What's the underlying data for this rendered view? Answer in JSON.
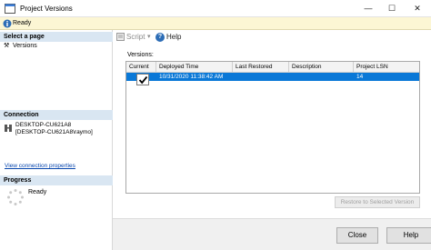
{
  "window": {
    "title": "Project Versions",
    "minimize_symbol": "—",
    "maximize_symbol": "☐",
    "close_symbol": "✕"
  },
  "status": {
    "text": "Ready"
  },
  "left_pane": {
    "select_page_header": "Select a page",
    "pages": [
      {
        "label": "Versions",
        "icon": "wrench-icon"
      }
    ],
    "connection_header": "Connection",
    "connection_lines": [
      "DESKTOP-CU621A8",
      "[DESKTOP-CU621A8\\raymo]"
    ],
    "view_connection_link": "View connection properties",
    "progress_header": "Progress",
    "progress_status": "Ready"
  },
  "toolbar": {
    "script_label": "Script",
    "dropdown_arrow": "▾",
    "help_label": "Help",
    "help_symbol": "?"
  },
  "versions": {
    "label": "Versions:",
    "columns": [
      "Current",
      "Deployed Time",
      "Last Restored",
      "Description",
      "Project LSN"
    ],
    "rows": [
      {
        "current": true,
        "deployed_time": "10/31/2020 11:38:42 AM",
        "last_restored": "",
        "description": "",
        "project_lsn": "14"
      }
    ]
  },
  "buttons": {
    "restore": "Restore to Selected Version",
    "close": "Close",
    "help": "Help"
  },
  "colors": {
    "selection": "#0a78d7",
    "status_bar": "#fcf6d4",
    "section_header": "#d9e6f2",
    "link": "#0645ad"
  }
}
